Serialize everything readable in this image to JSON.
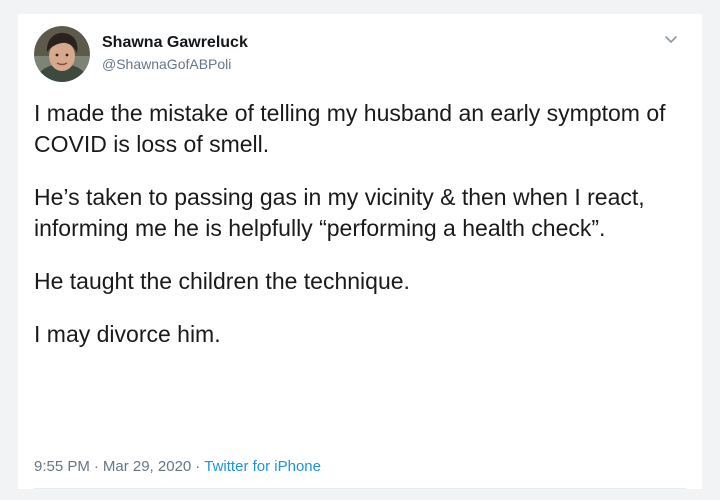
{
  "tweet": {
    "author": {
      "display_name": "Shawna Gawreluck",
      "handle": "@ShawnaGofABPoli"
    },
    "menu_icon": "chevron-down-icon",
    "paragraphs": [
      "I made the mistake of telling my husband an early symptom of COVID is loss of smell.",
      "He’s taken to passing gas in my vicinity & then when I react, informing me he is helpfully “performing a health check”.",
      "He taught the children the technique.",
      "I may divorce him."
    ],
    "time": "9:55 PM",
    "date": "Mar 29, 2020",
    "source": "Twitter for iPhone",
    "separator": "·"
  },
  "colors": {
    "text": "#14171a",
    "muted": "#657786",
    "link": "#1b95e0",
    "background": "#f1f3f5"
  }
}
